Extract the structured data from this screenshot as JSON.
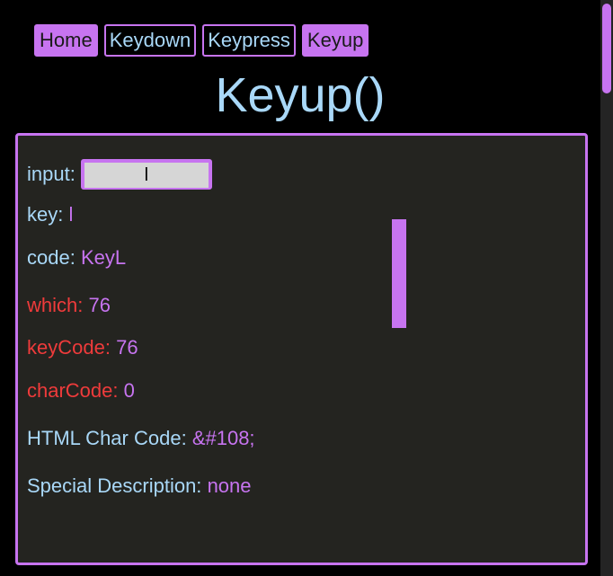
{
  "nav": {
    "items": [
      {
        "label": "Home",
        "active": true
      },
      {
        "label": "Keydown",
        "active": false
      },
      {
        "label": "Keypress",
        "active": false
      },
      {
        "label": "Keyup",
        "active": true
      }
    ]
  },
  "title": "Keyup()",
  "panel": {
    "input": {
      "label": "input:",
      "value": "l"
    },
    "key": {
      "label": "key:",
      "value": "l"
    },
    "code": {
      "label": "code:",
      "value": "KeyL"
    },
    "which": {
      "label": "which:",
      "value": "76"
    },
    "keyCode": {
      "label": "keyCode:",
      "value": "76"
    },
    "charCode": {
      "label": "charCode:",
      "value": "0"
    },
    "htmlCharCode": {
      "label": "HTML Char Code:",
      "value": "&#108;"
    },
    "specialDescription": {
      "label": "Special Description:",
      "value": "none"
    },
    "displayed_char": "l"
  },
  "colors": {
    "background": "#000000",
    "panel": "#242420",
    "accent": "#c774f0",
    "text": "#a9d8f8",
    "deprecated_label": "#ef3b3b"
  }
}
